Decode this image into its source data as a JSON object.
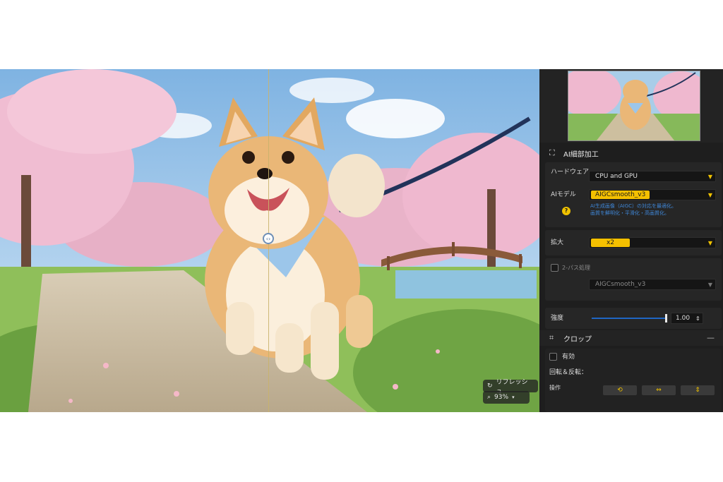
{
  "preview": {
    "refresh_label": "リフレッシュ",
    "zoom_label": "93%",
    "refresh_icon": "refresh-icon",
    "zoom_icon": "magnifier-icon"
  },
  "panel": {
    "ai_section": {
      "title": "AI細部加工",
      "icon": "crop-enhance-icon",
      "hardware_label": "ハードウェア",
      "hardware_value": "CPU and GPU",
      "model_label": "AIモデル",
      "model_value": "AIGCsmooth_v3",
      "model_note_line1": "AI生成画像（AIGC）の対応を最適化。",
      "model_note_line2": "画質を鮮明化・平滑化・高画質化。",
      "scale_label": "拡大",
      "scale_value": "x2",
      "two_pass_label": "2-パス処理",
      "two_pass_model": "AIGCsmooth_v3",
      "strength_label": "強度",
      "strength_value": "1.00",
      "strength_fraction": 1.0
    },
    "crop_section": {
      "title": "クロップ",
      "collapse_symbol": "—",
      "enable_label": "有効",
      "rotate_label": "回転＆反転：",
      "operation_label": "操作",
      "buttons": [
        "rotate-icon",
        "flip-horizontal-icon",
        "flip-vertical-icon"
      ]
    }
  },
  "colors": {
    "accent": "#f5c000",
    "panel_bg": "#1e1e1e",
    "note_blue": "#3f86d6",
    "slider_blue": "#1f66c4"
  }
}
